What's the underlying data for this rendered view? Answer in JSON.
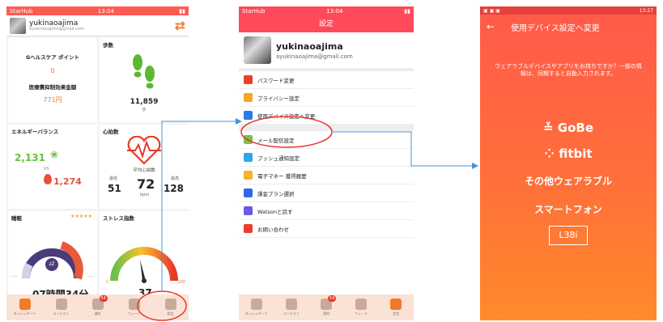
{
  "screen1": {
    "status": {
      "carrier": "StarHub",
      "time": "13:04"
    },
    "user": {
      "name": "yukinaoajima",
      "email": "ayukinaoajima@gmail.com"
    },
    "cards": {
      "gpoint_title": "Gヘルスケア ポイント",
      "gpoint_value": "0",
      "medical_title": "医療費抑制効果金額",
      "medical_value": "771円",
      "steps_title": "歩数",
      "steps_value": "11,859",
      "steps_unit": "歩",
      "energy_title": "エネルギーバランス",
      "energy_intake": "2,131",
      "energy_vs": "VS",
      "energy_burn": "1,274",
      "heart_title": "心拍数",
      "heart_sub": "平均心拍数",
      "heart_min_label": "最低",
      "heart_max_label": "最高",
      "heart_min": "51",
      "heart_avg": "72",
      "heart_unit": "bpm",
      "heart_max": "128",
      "sleep_title": "睡眠",
      "sleep_stars": "★★★★★",
      "sleep_dash": "--:--",
      "sleep_value": "07時間34分",
      "stress_title": "ストレス指数",
      "stress_min": "0",
      "stress_max": "100",
      "stress_value": "37"
    },
    "tabs": [
      {
        "label": "ダッシュボード"
      },
      {
        "label": "コンテスト"
      },
      {
        "label": "通知",
        "badge": "54"
      },
      {
        "label": "フィード"
      },
      {
        "label": "設定"
      }
    ]
  },
  "screen2": {
    "status": {
      "carrier": "StarHub",
      "time": "13:04"
    },
    "title": "設定",
    "user": {
      "name": "yukinaoajima",
      "email": "ayukinaoajima@gmail.com"
    },
    "items": [
      {
        "label": "パスワード変更",
        "color": "#e8402a"
      },
      {
        "label": "プライバシー設定",
        "color": "#f5a623"
      },
      {
        "label": "使用デバイス設定へ変更",
        "color": "#2a7ae8"
      },
      {
        "label": "メール配信設定",
        "color": "#7ac14a"
      },
      {
        "label": "プッシュ通知設定",
        "color": "#2aa8e8"
      },
      {
        "label": "電子マネー 獲得履歴",
        "color": "#f5b22a"
      },
      {
        "label": "課金プラン選択",
        "color": "#2a6ae8"
      },
      {
        "label": "Watsonと話す",
        "color": "#6a5ae8"
      },
      {
        "label": "お問い合わせ",
        "color": "#e8402a"
      }
    ],
    "tabs": [
      {
        "label": "ダッシュボード"
      },
      {
        "label": "コンテスト"
      },
      {
        "label": "通知",
        "badge": "54"
      },
      {
        "label": "フィード"
      },
      {
        "label": "設定"
      }
    ]
  },
  "screen3": {
    "status": {
      "time": "13:27"
    },
    "title": "使用デバイス設定へ変更",
    "description": "ウェアラブルデバイスやアプリをお持ちですか？一部の情報は、同期すると自動入力されます。",
    "options": [
      "GoBe",
      "fitbit",
      "その他ウェアラブル",
      "スマートフォン",
      "L38i"
    ]
  },
  "colors": {
    "accent_red": "#ff4a5a",
    "orange": "#f07a2a",
    "annotation_red": "#e8382a",
    "arrow_blue": "#4a90d9"
  }
}
